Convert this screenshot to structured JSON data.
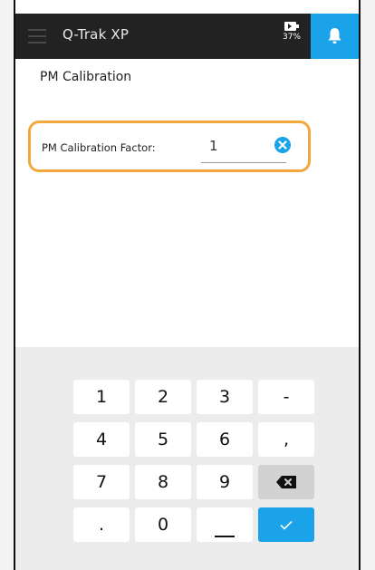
{
  "header": {
    "title": "Q-Trak XP",
    "battery_percent": "37%"
  },
  "page": {
    "title": "PM Calibration"
  },
  "field": {
    "label": "PM Calibration Factor:",
    "value": "1",
    "highlight_color": "#f2a83a"
  },
  "keypad": {
    "keys": [
      "1",
      "2",
      "3",
      "-",
      "4",
      "5",
      "6",
      ",",
      "7",
      "8",
      "9",
      "backspace",
      ".",
      "0",
      "_",
      "confirm"
    ],
    "labels": {
      "k1": "1",
      "k2": "2",
      "k3": "3",
      "minus": "-",
      "k4": "4",
      "k5": "5",
      "k6": "6",
      "comma": ",",
      "k7": "7",
      "k8": "8",
      "k9": "9",
      "dot": ".",
      "k0": "0"
    }
  },
  "colors": {
    "accent": "#1aa3e8",
    "topbar": "#222222",
    "keypad_bg": "#ececec"
  },
  "icons": [
    "menu-icon",
    "battery-icon",
    "bell-icon",
    "clear-icon",
    "backspace-icon",
    "checkmark-icon"
  ]
}
